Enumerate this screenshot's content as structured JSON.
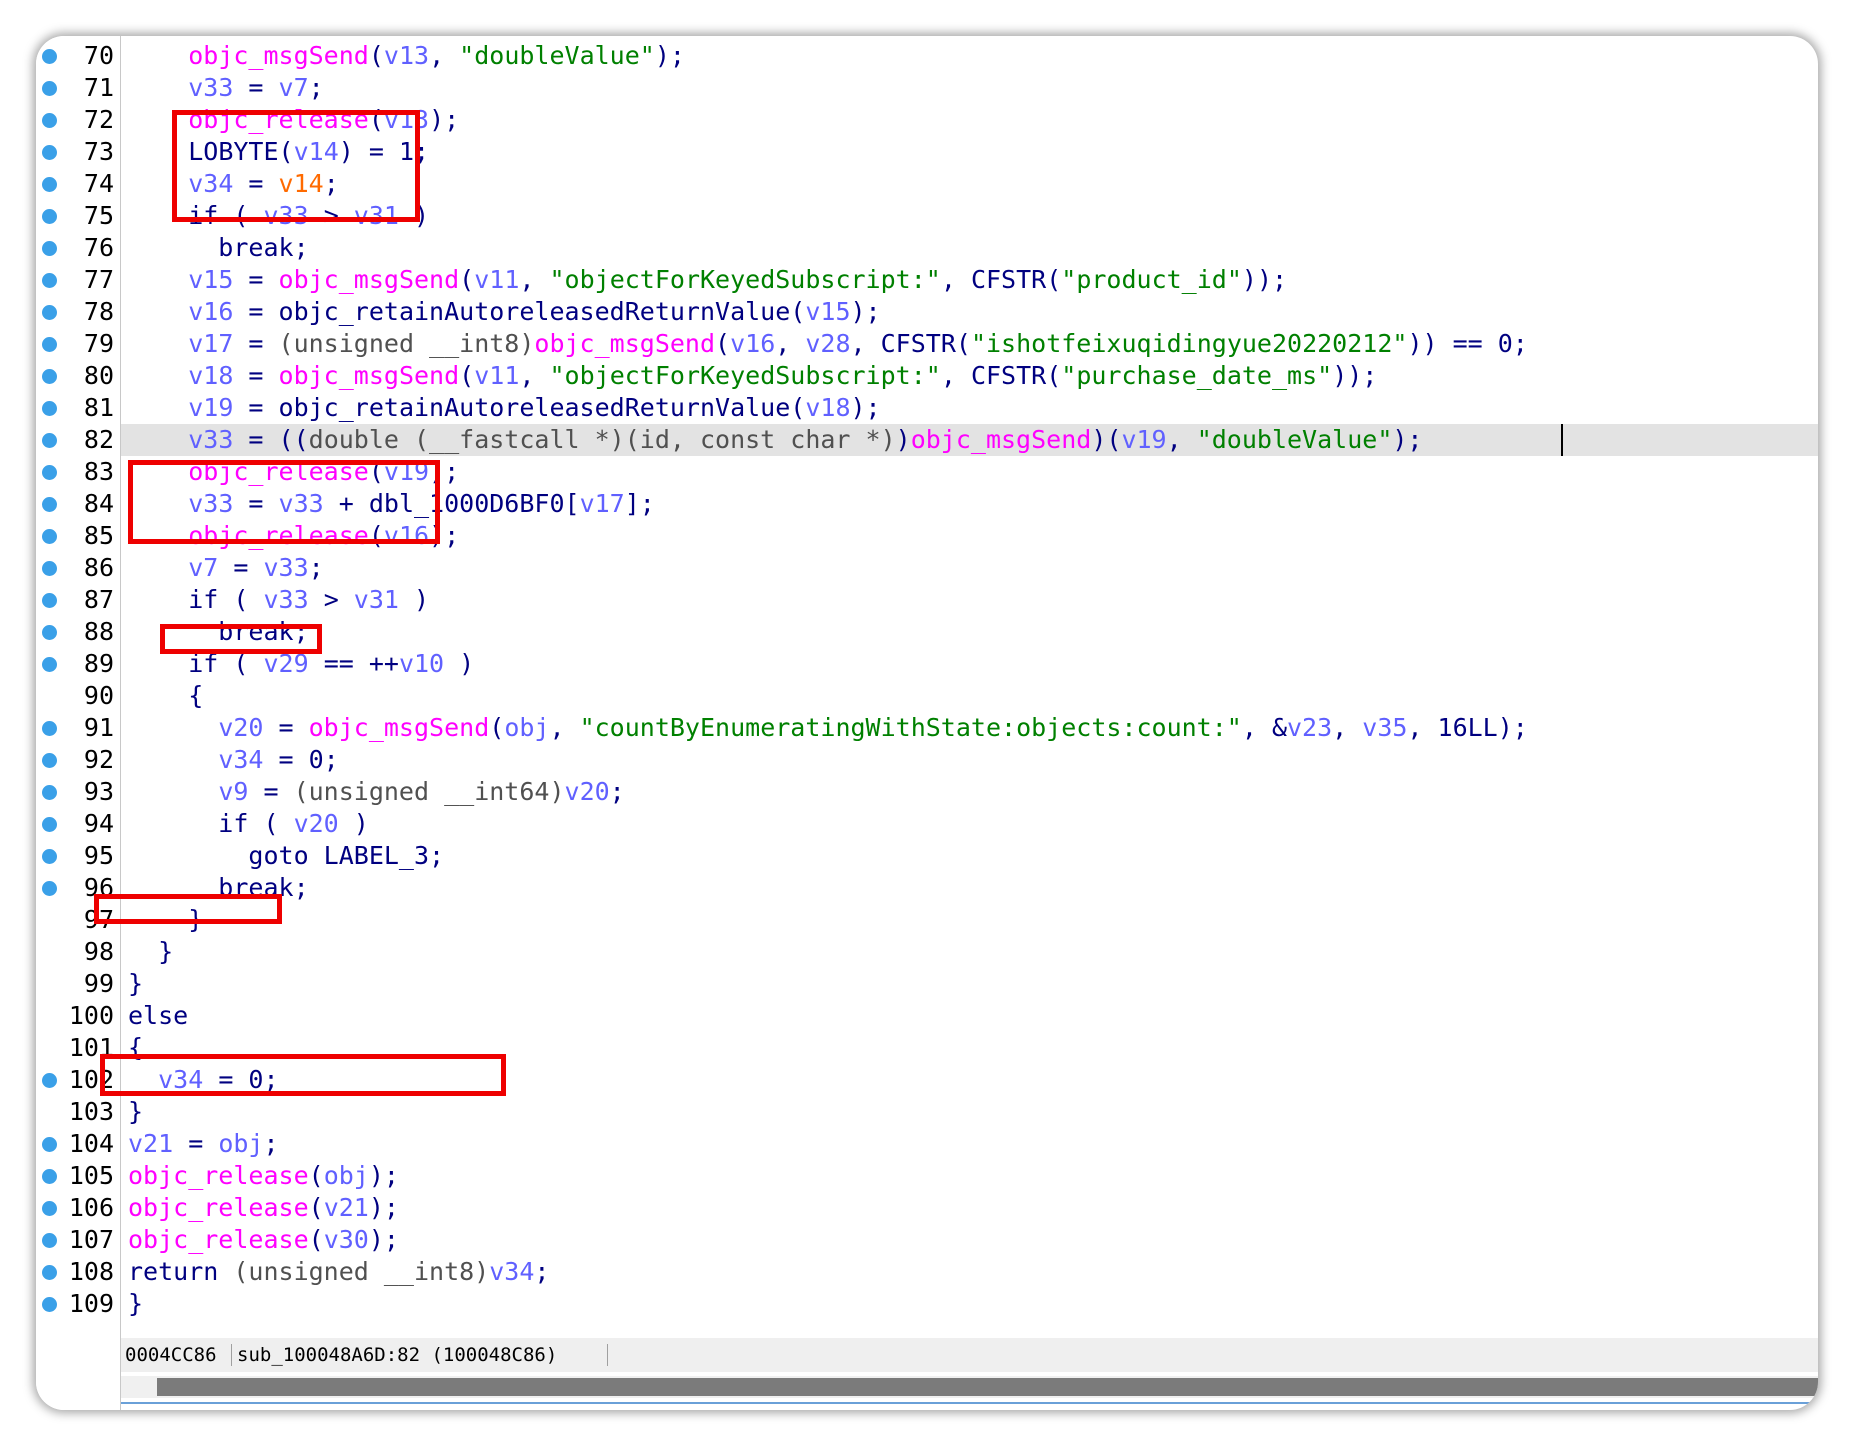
{
  "editor": {
    "current_line": 82,
    "lines": [
      {
        "n": "70",
        "bp": true,
        "tokens": [
          [
            "    ",
            "t-txt"
          ],
          [
            "objc_msgSend",
            "t-fn"
          ],
          [
            "(",
            "t-txt"
          ],
          [
            "v13",
            "t-var"
          ],
          [
            ", ",
            "t-txt"
          ],
          [
            "\"doubleValue\"",
            "t-str"
          ],
          [
            ");",
            "t-txt"
          ]
        ]
      },
      {
        "n": "71",
        "bp": true,
        "tokens": [
          [
            "    ",
            "t-txt"
          ],
          [
            "v33",
            "t-var"
          ],
          [
            " = ",
            "t-txt"
          ],
          [
            "v7",
            "t-var"
          ],
          [
            ";",
            "t-txt"
          ]
        ]
      },
      {
        "n": "72",
        "bp": true,
        "tokens": [
          [
            "    ",
            "t-txt"
          ],
          [
            "objc_release",
            "t-fn"
          ],
          [
            "(",
            "t-txt"
          ],
          [
            "v13",
            "t-var"
          ],
          [
            ");",
            "t-txt"
          ]
        ]
      },
      {
        "n": "73",
        "bp": true,
        "tokens": [
          [
            "    ",
            "t-txt"
          ],
          [
            "LOBYTE",
            "t-txt"
          ],
          [
            "(",
            "t-txt"
          ],
          [
            "v14",
            "t-var"
          ],
          [
            ") = 1;",
            "t-txt"
          ]
        ]
      },
      {
        "n": "74",
        "bp": true,
        "tokens": [
          [
            "    ",
            "t-txt"
          ],
          [
            "v34",
            "t-var"
          ],
          [
            " = ",
            "t-txt"
          ],
          [
            "v14",
            "t-org"
          ],
          [
            ";",
            "t-txt"
          ]
        ]
      },
      {
        "n": "75",
        "bp": true,
        "tokens": [
          [
            "    ",
            "t-txt"
          ],
          [
            "if ( ",
            "t-txt"
          ],
          [
            "v33",
            "t-var"
          ],
          [
            " > ",
            "t-txt"
          ],
          [
            "v31",
            "t-var"
          ],
          [
            " )",
            "t-txt"
          ]
        ]
      },
      {
        "n": "76",
        "bp": true,
        "tokens": [
          [
            "      break;",
            "t-txt"
          ]
        ]
      },
      {
        "n": "77",
        "bp": true,
        "tokens": [
          [
            "    ",
            "t-txt"
          ],
          [
            "v15",
            "t-var"
          ],
          [
            " = ",
            "t-txt"
          ],
          [
            "objc_msgSend",
            "t-fn"
          ],
          [
            "(",
            "t-txt"
          ],
          [
            "v11",
            "t-var"
          ],
          [
            ", ",
            "t-txt"
          ],
          [
            "\"objectForKeyedSubscript:\"",
            "t-str"
          ],
          [
            ", ",
            "t-txt"
          ],
          [
            "CFSTR",
            "t-blk"
          ],
          [
            "(",
            "t-txt"
          ],
          [
            "\"product_id\"",
            "t-str"
          ],
          [
            "));",
            "t-txt"
          ]
        ]
      },
      {
        "n": "78",
        "bp": true,
        "tokens": [
          [
            "    ",
            "t-txt"
          ],
          [
            "v16",
            "t-var"
          ],
          [
            " = ",
            "t-txt"
          ],
          [
            "objc_retainAutoreleasedReturnValue",
            "t-blk"
          ],
          [
            "(",
            "t-txt"
          ],
          [
            "v15",
            "t-var"
          ],
          [
            ");",
            "t-txt"
          ]
        ]
      },
      {
        "n": "79",
        "bp": true,
        "tokens": [
          [
            "    ",
            "t-txt"
          ],
          [
            "v17",
            "t-var"
          ],
          [
            " = ",
            "t-txt"
          ],
          [
            "(unsigned __int8)",
            "t-typ"
          ],
          [
            "objc_msgSend",
            "t-fn"
          ],
          [
            "(",
            "t-txt"
          ],
          [
            "v16",
            "t-var"
          ],
          [
            ", ",
            "t-txt"
          ],
          [
            "v28",
            "t-var"
          ],
          [
            ", ",
            "t-txt"
          ],
          [
            "CFSTR",
            "t-blk"
          ],
          [
            "(",
            "t-txt"
          ],
          [
            "\"ishotfeixuqidingyue20220212\"",
            "t-str"
          ],
          [
            ")) == 0;",
            "t-txt"
          ]
        ]
      },
      {
        "n": "80",
        "bp": true,
        "tokens": [
          [
            "    ",
            "t-txt"
          ],
          [
            "v18",
            "t-var"
          ],
          [
            " = ",
            "t-txt"
          ],
          [
            "objc_msgSend",
            "t-fn"
          ],
          [
            "(",
            "t-txt"
          ],
          [
            "v11",
            "t-var"
          ],
          [
            ", ",
            "t-txt"
          ],
          [
            "\"objectForKeyedSubscript:\"",
            "t-str"
          ],
          [
            ", ",
            "t-txt"
          ],
          [
            "CFSTR",
            "t-blk"
          ],
          [
            "(",
            "t-txt"
          ],
          [
            "\"purchase_date_ms\"",
            "t-str"
          ],
          [
            "));",
            "t-txt"
          ]
        ]
      },
      {
        "n": "81",
        "bp": true,
        "tokens": [
          [
            "    ",
            "t-txt"
          ],
          [
            "v19",
            "t-var"
          ],
          [
            " = ",
            "t-txt"
          ],
          [
            "objc_retainAutoreleasedReturnValue",
            "t-blk"
          ],
          [
            "(",
            "t-txt"
          ],
          [
            "v18",
            "t-var"
          ],
          [
            ");",
            "t-txt"
          ]
        ]
      },
      {
        "n": "82",
        "bp": true,
        "tokens": [
          [
            "    ",
            "t-txt"
          ],
          [
            "v33",
            "t-var"
          ],
          [
            " = ((",
            "t-txt"
          ],
          [
            "double (__fastcall *)(id, const char *)",
            "t-typ"
          ],
          [
            ")",
            "t-txt"
          ],
          [
            "objc_msgSend",
            "t-fn"
          ],
          [
            ")(",
            "t-txt"
          ],
          [
            "v19",
            "t-var"
          ],
          [
            ", ",
            "t-txt"
          ],
          [
            "\"doubleValue\"",
            "t-str"
          ],
          [
            ");",
            "t-txt"
          ]
        ]
      },
      {
        "n": "83",
        "bp": true,
        "tokens": [
          [
            "    ",
            "t-txt"
          ],
          [
            "objc_release",
            "t-fn"
          ],
          [
            "(",
            "t-txt"
          ],
          [
            "v19",
            "t-var"
          ],
          [
            ");",
            "t-txt"
          ]
        ]
      },
      {
        "n": "84",
        "bp": true,
        "tokens": [
          [
            "    ",
            "t-txt"
          ],
          [
            "v33",
            "t-var"
          ],
          [
            " = ",
            "t-txt"
          ],
          [
            "v33",
            "t-var"
          ],
          [
            " + dbl_1000D6BF0[",
            "t-txt"
          ],
          [
            "v17",
            "t-var"
          ],
          [
            "];",
            "t-txt"
          ]
        ]
      },
      {
        "n": "85",
        "bp": true,
        "tokens": [
          [
            "    ",
            "t-txt"
          ],
          [
            "objc_release",
            "t-fn"
          ],
          [
            "(",
            "t-txt"
          ],
          [
            "v16",
            "t-var"
          ],
          [
            ");",
            "t-txt"
          ]
        ]
      },
      {
        "n": "86",
        "bp": true,
        "tokens": [
          [
            "    ",
            "t-txt"
          ],
          [
            "v7",
            "t-var"
          ],
          [
            " = ",
            "t-txt"
          ],
          [
            "v33",
            "t-var"
          ],
          [
            ";",
            "t-txt"
          ]
        ]
      },
      {
        "n": "87",
        "bp": true,
        "tokens": [
          [
            "    ",
            "t-txt"
          ],
          [
            "if ( ",
            "t-txt"
          ],
          [
            "v33",
            "t-var"
          ],
          [
            " > ",
            "t-txt"
          ],
          [
            "v31",
            "t-var"
          ],
          [
            " )",
            "t-txt"
          ]
        ]
      },
      {
        "n": "88",
        "bp": true,
        "tokens": [
          [
            "      break;",
            "t-txt"
          ]
        ]
      },
      {
        "n": "89",
        "bp": true,
        "tokens": [
          [
            "    ",
            "t-txt"
          ],
          [
            "if ( ",
            "t-txt"
          ],
          [
            "v29",
            "t-var"
          ],
          [
            " == ++",
            "t-txt"
          ],
          [
            "v10",
            "t-var"
          ],
          [
            " )",
            "t-txt"
          ]
        ]
      },
      {
        "n": "90",
        "bp": false,
        "tokens": [
          [
            "    {",
            "t-txt"
          ]
        ]
      },
      {
        "n": "91",
        "bp": true,
        "tokens": [
          [
            "      ",
            "t-txt"
          ],
          [
            "v20",
            "t-var"
          ],
          [
            " = ",
            "t-txt"
          ],
          [
            "objc_msgSend",
            "t-fn"
          ],
          [
            "(",
            "t-txt"
          ],
          [
            "obj",
            "t-var"
          ],
          [
            ", ",
            "t-txt"
          ],
          [
            "\"countByEnumeratingWithState:objects:count:\"",
            "t-str"
          ],
          [
            ", &",
            "t-txt"
          ],
          [
            "v23",
            "t-var"
          ],
          [
            ", ",
            "t-txt"
          ],
          [
            "v35",
            "t-var"
          ],
          [
            ", 16LL);",
            "t-txt"
          ]
        ]
      },
      {
        "n": "92",
        "bp": true,
        "tokens": [
          [
            "      ",
            "t-txt"
          ],
          [
            "v34",
            "t-var"
          ],
          [
            " = 0;",
            "t-txt"
          ]
        ]
      },
      {
        "n": "93",
        "bp": true,
        "tokens": [
          [
            "      ",
            "t-txt"
          ],
          [
            "v9",
            "t-var"
          ],
          [
            " = ",
            "t-txt"
          ],
          [
            "(unsigned __int64)",
            "t-typ"
          ],
          [
            "v20",
            "t-var"
          ],
          [
            ";",
            "t-txt"
          ]
        ]
      },
      {
        "n": "94",
        "bp": true,
        "tokens": [
          [
            "      if ( ",
            "t-txt"
          ],
          [
            "v20",
            "t-var"
          ],
          [
            " )",
            "t-txt"
          ]
        ]
      },
      {
        "n": "95",
        "bp": true,
        "tokens": [
          [
            "        goto LABEL_3;",
            "t-txt"
          ]
        ]
      },
      {
        "n": "96",
        "bp": true,
        "tokens": [
          [
            "      break;",
            "t-txt"
          ]
        ]
      },
      {
        "n": "97",
        "bp": false,
        "tokens": [
          [
            "    }",
            "t-txt"
          ]
        ]
      },
      {
        "n": "98",
        "bp": false,
        "tokens": [
          [
            "  }",
            "t-txt"
          ]
        ]
      },
      {
        "n": "99",
        "bp": false,
        "tokens": [
          [
            "}",
            "t-txt"
          ]
        ]
      },
      {
        "n": "100",
        "bp": false,
        "tokens": [
          [
            "else",
            "t-txt"
          ]
        ]
      },
      {
        "n": "101",
        "bp": false,
        "tokens": [
          [
            "{",
            "t-txt"
          ]
        ]
      },
      {
        "n": "102",
        "bp": true,
        "tokens": [
          [
            "  ",
            "t-txt"
          ],
          [
            "v34",
            "t-var"
          ],
          [
            " = 0;",
            "t-txt"
          ]
        ]
      },
      {
        "n": "103",
        "bp": false,
        "tokens": [
          [
            "}",
            "t-txt"
          ]
        ]
      },
      {
        "n": "104",
        "bp": true,
        "tokens": [
          [
            "v21",
            "t-var"
          ],
          [
            " = ",
            "t-txt"
          ],
          [
            "obj",
            "t-var"
          ],
          [
            ";",
            "t-txt"
          ]
        ]
      },
      {
        "n": "105",
        "bp": true,
        "tokens": [
          [
            "objc_release",
            "t-fn"
          ],
          [
            "(",
            "t-txt"
          ],
          [
            "obj",
            "t-var"
          ],
          [
            ");",
            "t-txt"
          ]
        ]
      },
      {
        "n": "106",
        "bp": true,
        "tokens": [
          [
            "objc_release",
            "t-fn"
          ],
          [
            "(",
            "t-txt"
          ],
          [
            "v21",
            "t-var"
          ],
          [
            ");",
            "t-txt"
          ]
        ]
      },
      {
        "n": "107",
        "bp": true,
        "tokens": [
          [
            "objc_release",
            "t-fn"
          ],
          [
            "(",
            "t-txt"
          ],
          [
            "v30",
            "t-var"
          ],
          [
            ");",
            "t-txt"
          ]
        ]
      },
      {
        "n": "108",
        "bp": true,
        "tokens": [
          [
            "return ",
            "t-txt"
          ],
          [
            "(unsigned __int8)",
            "t-typ"
          ],
          [
            "v34",
            "t-var"
          ],
          [
            ";",
            "t-txt"
          ]
        ]
      },
      {
        "n": "109",
        "bp": true,
        "tokens": [
          [
            "}",
            "t-txt"
          ]
        ]
      }
    ]
  },
  "statusbar": {
    "address": "0004CC86",
    "location": "sub_100048A6D:82 (100048C86)"
  },
  "colors": {
    "breakpoint": "#3aa0e8",
    "highlight_box": "#ee0000",
    "function": "#ff00ff",
    "variable": "#6060ff",
    "string": "#008000"
  }
}
